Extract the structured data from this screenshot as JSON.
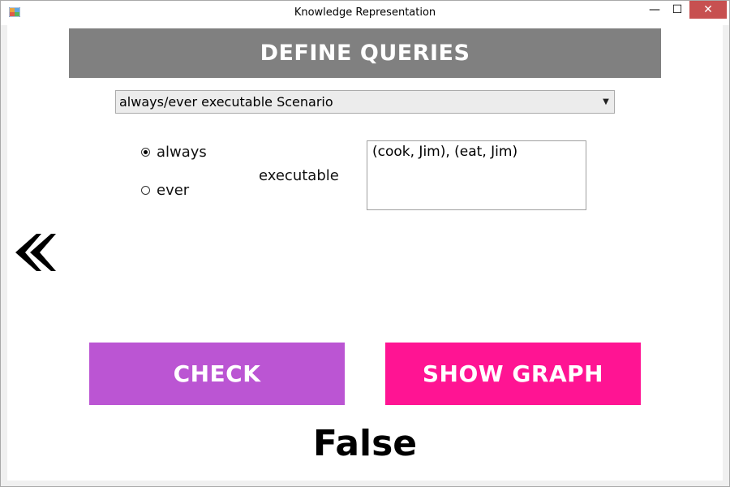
{
  "window": {
    "title": "Knowledge Representation",
    "controls": {
      "minimize": "—",
      "maximize": "☐",
      "close": "✕"
    }
  },
  "header": {
    "title": "DEFINE QUERIES"
  },
  "query_type": {
    "selected": "always/ever executable Scenario"
  },
  "modes": [
    {
      "label": "always",
      "checked": true
    },
    {
      "label": "ever",
      "checked": false
    }
  ],
  "executable_label": "executable",
  "scenario_input": {
    "value": "(cook, Jim), (eat, Jim)"
  },
  "buttons": {
    "check": "CHECK",
    "show_graph": "SHOW GRAPH"
  },
  "result": "False",
  "colors": {
    "header_bg": "#808080",
    "check_bg": "#bb55d3",
    "show_graph_bg": "#ff1493",
    "close_bg": "#c75050"
  },
  "icons": {
    "back": "double-chevron-left-icon",
    "app": "app-icon"
  }
}
